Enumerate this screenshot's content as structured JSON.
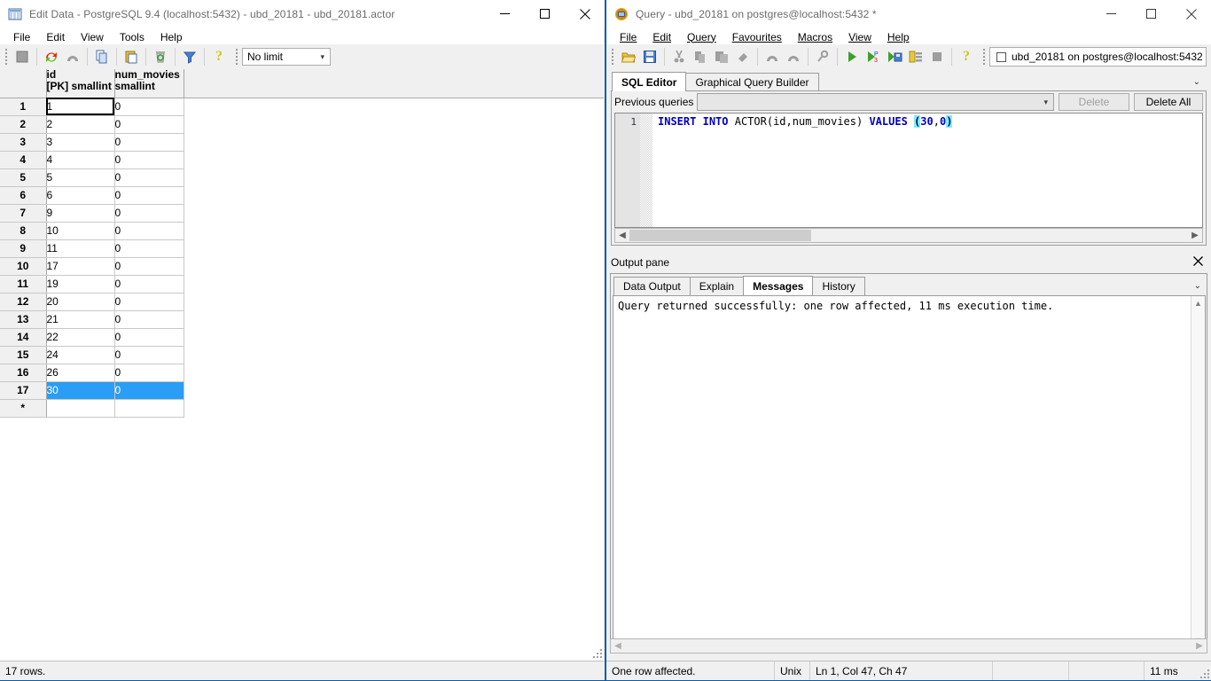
{
  "left_window": {
    "title": "Edit Data - PostgreSQL 9.4 (localhost:5432) - ubd_20181 - ubd_20181.actor",
    "icon": "grid-table-icon",
    "window_buttons": {
      "minimize": "minimize-icon",
      "maximize": "maximize-icon",
      "close": "close-icon"
    },
    "menus": [
      "File",
      "Edit",
      "View",
      "Tools",
      "Help"
    ],
    "toolbar": {
      "icons": [
        "save-icon",
        "refresh-icon",
        "undo-icon",
        "copy-icon",
        "paste-icon",
        "delete-icon",
        "filter-icon",
        "help-icon"
      ],
      "limit_combo": {
        "value": "No limit"
      }
    },
    "grid": {
      "columns": [
        {
          "name": "id",
          "type": "[PK] smallint"
        },
        {
          "name": "num_movies",
          "type": "smallint"
        }
      ],
      "rows": [
        {
          "n": "1",
          "id": "1",
          "num_movies": "0"
        },
        {
          "n": "2",
          "id": "2",
          "num_movies": "0"
        },
        {
          "n": "3",
          "id": "3",
          "num_movies": "0"
        },
        {
          "n": "4",
          "id": "4",
          "num_movies": "0"
        },
        {
          "n": "5",
          "id": "5",
          "num_movies": "0"
        },
        {
          "n": "6",
          "id": "6",
          "num_movies": "0"
        },
        {
          "n": "7",
          "id": "9",
          "num_movies": "0"
        },
        {
          "n": "8",
          "id": "10",
          "num_movies": "0"
        },
        {
          "n": "9",
          "id": "11",
          "num_movies": "0"
        },
        {
          "n": "10",
          "id": "17",
          "num_movies": "0"
        },
        {
          "n": "11",
          "id": "19",
          "num_movies": "0"
        },
        {
          "n": "12",
          "id": "20",
          "num_movies": "0"
        },
        {
          "n": "13",
          "id": "21",
          "num_movies": "0"
        },
        {
          "n": "14",
          "id": "22",
          "num_movies": "0"
        },
        {
          "n": "15",
          "id": "24",
          "num_movies": "0"
        },
        {
          "n": "16",
          "id": "26",
          "num_movies": "0"
        },
        {
          "n": "17",
          "id": "30",
          "num_movies": "0"
        },
        {
          "n": "*",
          "id": "",
          "num_movies": ""
        }
      ],
      "selected_row_index": 16,
      "focused_cell": {
        "row": 0,
        "col": 0
      }
    },
    "statusbar": {
      "rows_text": "17 rows."
    }
  },
  "right_window": {
    "title": "Query - ubd_20181 on postgres@localhost:5432 *",
    "icon": "pgadmin-query-icon",
    "window_buttons": {
      "minimize": "minimize-icon",
      "maximize": "maximize-icon",
      "close": "close-icon"
    },
    "menus": [
      "File",
      "Edit",
      "Query",
      "Favourites",
      "Macros",
      "View",
      "Help"
    ],
    "toolbar": {
      "icons": [
        "open-file-icon",
        "save-icon",
        "cut-icon",
        "copy-icon",
        "paste-icon",
        "clear-icon",
        "undo-icon",
        "redo-icon",
        "find-icon",
        "execute-icon",
        "explain-icon",
        "execute-to-file-icon",
        "explain-analyze-icon",
        "stop-icon",
        "help-icon"
      ],
      "connection_combo": {
        "value": "ubd_20181 on postgres@localhost:5432",
        "checkbox": "unchecked"
      }
    },
    "tabs": [
      {
        "label": "SQL Editor",
        "active": true
      },
      {
        "label": "Graphical Query Builder",
        "active": false
      }
    ],
    "tabstrip_overflow_icon": "chevron-down-icon",
    "previous_queries": {
      "label": "Previous queries",
      "combo_value": "",
      "delete_button": "Delete",
      "delete_all_button": "Delete All"
    },
    "sql_editor": {
      "line_number": "1",
      "tokens": [
        {
          "text": "INSERT",
          "kind": "keyword"
        },
        {
          "text": " ",
          "kind": "plain"
        },
        {
          "text": "INTO",
          "kind": "keyword"
        },
        {
          "text": " ACTOR(id,num_movies) ",
          "kind": "plain"
        },
        {
          "text": "VALUES",
          "kind": "keyword"
        },
        {
          "text": " ",
          "kind": "plain"
        },
        {
          "text": "(",
          "kind": "brace-highlight"
        },
        {
          "text": "30",
          "kind": "number"
        },
        {
          "text": ",",
          "kind": "plain"
        },
        {
          "text": "0",
          "kind": "number"
        },
        {
          "text": ")",
          "kind": "brace-highlight"
        }
      ],
      "full_text": "INSERT INTO ACTOR(id,num_movies) VALUES (30,0)"
    },
    "output_pane": {
      "title": "Output pane",
      "close_icon": "close-icon",
      "overflow_icon": "chevron-down-icon",
      "tabs": [
        {
          "label": "Data Output",
          "active": false
        },
        {
          "label": "Explain",
          "active": false
        },
        {
          "label": "Messages",
          "active": true
        },
        {
          "label": "History",
          "active": false
        }
      ],
      "message": "Query returned successfully: one row affected, 11 ms execution time."
    },
    "statusbar": {
      "segment1": "One row affected.",
      "segment2": "Unix",
      "segment3": "Ln 1, Col 47, Ch 47",
      "segment4": "",
      "segment5": "",
      "segment6": "11 ms"
    }
  },
  "colors": {
    "window_border_active": "#0a5ca8",
    "chrome_bg": "#f0f0f0",
    "selection_blue": "#2a9df4",
    "keyword_blue": "#0000c0",
    "brace_highlight": "#80f0f0"
  }
}
